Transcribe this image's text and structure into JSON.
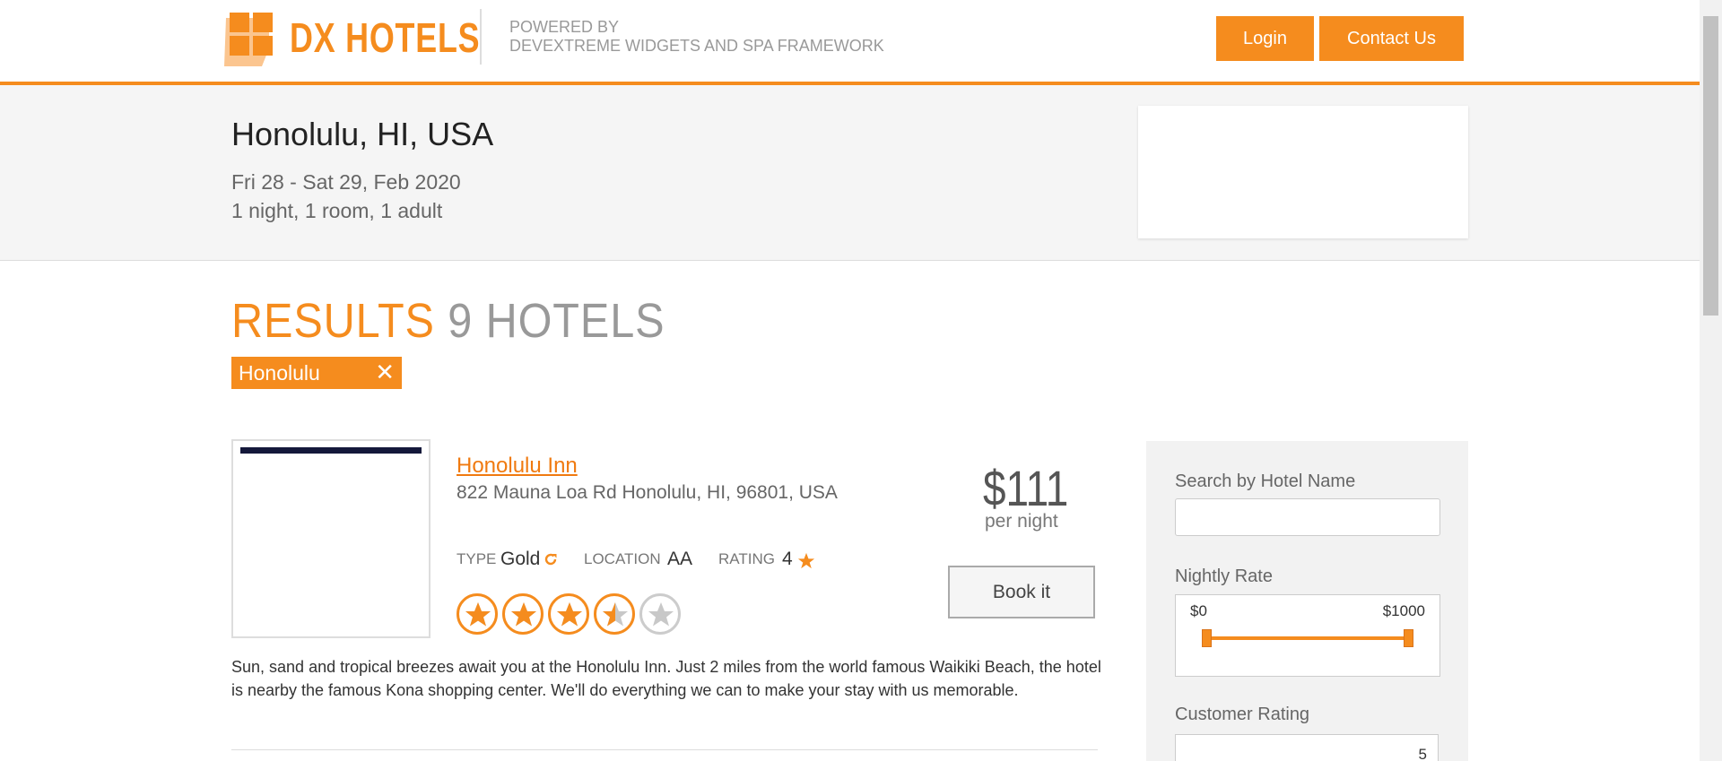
{
  "header": {
    "brand": "DX HOTELS",
    "powered_line1": "POWERED BY",
    "powered_line2": "DEVEXTREME WIDGETS AND SPA FRAMEWORK",
    "login_label": "Login",
    "contact_label": "Contact Us"
  },
  "search": {
    "city": "Honolulu, HI, USA",
    "dates": "Fri 28 - Sat 29, Feb 2020",
    "guests": "1 night, 1 room, 1 adult"
  },
  "results": {
    "label": "RESULTS",
    "count": "9 HOTELS",
    "filter_tag": "Honolulu",
    "remove_glyph": "✕"
  },
  "hotels": [
    {
      "name": "Honolulu Inn",
      "address": "822 Mauna Loa Rd Honolulu, HI, 96801, USA",
      "type_label": "TYPE",
      "type_value": "Gold",
      "location_label": "LOCATION",
      "location_value": "AA",
      "rating_label": "RATING",
      "rating_value": "4",
      "price": "$111",
      "price_unit": "per night",
      "book_label": "Book it",
      "stars": 3.5,
      "description": "Sun, sand and tropical breezes await you at the Honolulu Inn. Just 2 miles from the world famous Waikiki Beach, the hotel is nearby the famous Kona shopping center. We'll do everything we can to make your stay with us memorable."
    }
  ],
  "filters": {
    "hotel_name_label": "Search by Hotel Name",
    "hotel_name_value": "",
    "nightly_rate_label": "Nightly Rate",
    "rate_min": "$0",
    "rate_max": "$1000",
    "customer_rating_label": "Customer Rating",
    "customer_rating_value": "5"
  },
  "colors": {
    "accent": "#f58c1e",
    "link": "#f07a10"
  }
}
